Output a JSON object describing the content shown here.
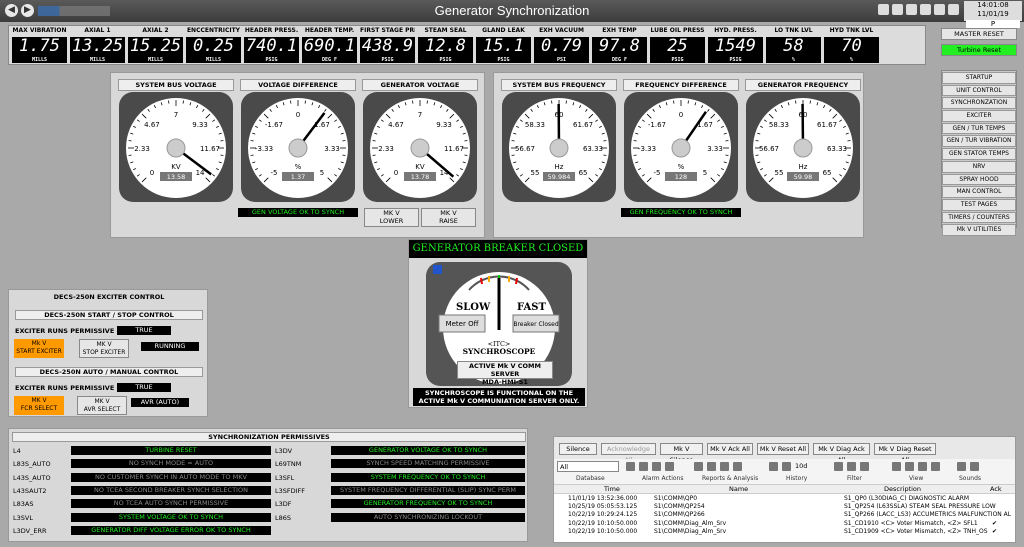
{
  "window": {
    "title": "Generator Synchronization",
    "clock_time": "14:01:08 11/01/19",
    "clock_user": "P",
    "nav_back": "◀",
    "nav_forward": "▶"
  },
  "readings": [
    {
      "label": "MAX VIBRATION",
      "value": "1.75",
      "unit": "MILLS"
    },
    {
      "label": "AXIAL 1",
      "value": "13.25",
      "unit": "MILLS"
    },
    {
      "label": "AXIAL 2",
      "value": "15.25",
      "unit": "MILLS"
    },
    {
      "label": "ENCCENTRICITY",
      "value": "0.25",
      "unit": "MILLS"
    },
    {
      "label": "HEADER PRESS.",
      "value": "740.1",
      "unit": "PSIG"
    },
    {
      "label": "HEADER TEMP.",
      "value": "690.1",
      "unit": "DEG F"
    },
    {
      "label": "FIRST STAGE PRESS",
      "value": "438.9",
      "unit": "PSIG"
    },
    {
      "label": "STEAM SEAL",
      "value": "12.8",
      "unit": "PSIG"
    },
    {
      "label": "GLAND LEAK",
      "value": "15.1",
      "unit": "PSIG"
    },
    {
      "label": "EXH VACUUM",
      "value": "0.79",
      "unit": "PSI"
    },
    {
      "label": "EXH TEMP",
      "value": "97.8",
      "unit": "DEG F"
    },
    {
      "label": "LUBE OIL PRESS",
      "value": "25",
      "unit": "PSIG"
    },
    {
      "label": "HYD. PRESS.",
      "value": "1549",
      "unit": "PSIG"
    },
    {
      "label": "LO TNK LVL",
      "value": "58",
      "unit": "%"
    },
    {
      "label": "HYD TNK LVL",
      "value": "70",
      "unit": "%"
    }
  ],
  "buttons": {
    "master_reset": "MASTER RESET",
    "turbine_reset": "Turbine Reset"
  },
  "nav_menu": [
    "STARTUP",
    "UNIT CONTROL",
    "SYNCHRONZATION",
    "EXCITER",
    "GEN / TUR TEMPS",
    "GEN / TUR VIBRATION",
    "GEN STATOR TEMPS",
    "NRV",
    "SPRAY HOOD",
    "MAN CONTROL",
    "TEST PAGES",
    "TIMERS / COUNTERS",
    "Mk V UTILITIES"
  ],
  "gauges": [
    {
      "title": "SYSTEM BUS VOLTAGE",
      "unit": "KV",
      "readout": "13.58",
      "ticks": [
        "0",
        "2.33",
        "4.67",
        "7",
        "9.33",
        "11.67",
        "14"
      ]
    },
    {
      "title": "VOLTAGE DIFFERENCE",
      "unit": "%",
      "readout": "1.37",
      "ticks": [
        "-5",
        "-3.33",
        "-1.67",
        "0",
        "1.67",
        "3.33",
        "5"
      ]
    },
    {
      "title": "GENERATOR VOLTAGE",
      "unit": "KV",
      "readout": "13.78",
      "ticks": [
        "0",
        "2.33",
        "4.67",
        "7",
        "9.33",
        "11.67",
        "14"
      ]
    },
    {
      "title": "SYSTEM BUS FREQUENCY",
      "unit": "Hz",
      "readout": "59.984",
      "ticks": [
        "55",
        "56.67",
        "58.33",
        "60",
        "61.67",
        "63.33",
        "65"
      ]
    },
    {
      "title": "FREQUENCY DIFFERENCE",
      "unit": "%",
      "readout": "128",
      "ticks": [
        "-5",
        "-3.33",
        "-1.67",
        "0",
        "1.67",
        "3.33",
        "5"
      ]
    },
    {
      "title": "GENERATOR FREQUENCY",
      "unit": "Hz",
      "readout": "59.98",
      "ticks": [
        "55",
        "56.67",
        "58.33",
        "60",
        "61.67",
        "63.33",
        "65"
      ]
    }
  ],
  "gauge_values": [
    13.58,
    1.37,
    13.78,
    59.984,
    1.28,
    59.98
  ],
  "gauge_ranges": [
    [
      0,
      14
    ],
    [
      -5,
      5
    ],
    [
      0,
      14
    ],
    [
      55,
      65
    ],
    [
      -5,
      5
    ],
    [
      55,
      65
    ]
  ],
  "status": {
    "gen_voltage_ok": "GEN VOLTAGE OK TO SYNCH",
    "gen_freq_ok": "GEN FREQUENCY OK TO SYNCH",
    "mkv_lower": "MK V\nLOWER",
    "mkv_raise": "MK V\nRAISE"
  },
  "synchroscope": {
    "header": "GENERATOR BREAKER CLOSED",
    "slow": "SLOW",
    "fast": "FAST",
    "meter_off": "Meter Off",
    "breaker": "Breaker Closed",
    "itc": "<ITC>",
    "name": "SYNCHROSCOPE",
    "server_line1": "ACTIVE Mk V COMM SERVER",
    "server_line2": "MDA-HMI-S1",
    "note1": "SYNCHROSCOPE IS FUNCTIONAL ON THE",
    "note2": "ACTIVE Mk V COMMUNIATION SERVER ONLY."
  },
  "decs": {
    "title": "DECS-250N EXCITER CONTROL",
    "start_stop": "DECS-250N START / STOP CONTROL",
    "exciter_runs_permissive": "EXCITER RUNS PERMISSIVE",
    "true1": "TRUE",
    "start_exciter": "Mk V\nSTART EXCITER",
    "stop_exciter": "MK V\nSTOP EXCITER",
    "running": "RUNNING",
    "auto_manual": "DECS-250N AUTO / MANUAL CONTROL",
    "exciter_runs_permissive2": "EXCITER RUNS PERMISSIVE",
    "true2": "TRUE",
    "fcr_select": "MK V\nFCR SELECT",
    "avr_select": "MK V\nAVR SELECT",
    "avr_auto": "AVR (AUTO)"
  },
  "permissives": {
    "title": "SYNCHRONIZATION PERMISSIVES",
    "left": [
      {
        "tag": "L4",
        "text": "TURBINE RESET",
        "state": "green"
      },
      {
        "tag": "L83S_AUTO",
        "text": "NO SYNCH MODE = AUTO",
        "state": "gray"
      },
      {
        "tag": "L43S_AUTO",
        "text": "NO CUSTOMER SYNCH  IN AUTO MODE TO MKV",
        "state": "gray"
      },
      {
        "tag": "L43SAUT2",
        "text": "NO TCEA SECOND BREAKER SYNCH SELECTION",
        "state": "gray"
      },
      {
        "tag": "L83AS",
        "text": "NO TCEA AUTO SYNCH PERMISSIVE",
        "state": "gray"
      },
      {
        "tag": "L3SVL",
        "text": "SYSTEM VOLTAGE OK TO SYNCH",
        "state": "green"
      },
      {
        "tag": "L3DV_ERR",
        "text": "GENERATOR DIFF VOLTAGE ERROR OK TO SYNCH",
        "state": "green"
      }
    ],
    "right": [
      {
        "tag": "L3DV",
        "text": "GENERATOR VOLTAGE OK TO SYNCH",
        "state": "green"
      },
      {
        "tag": "L69TNM",
        "text": "SYNCH SPEED MATCHING PERMISSIVE",
        "state": "gray"
      },
      {
        "tag": "L3SFL",
        "text": "SYSTEM FREQUENCY OK TO SYNCH",
        "state": "green"
      },
      {
        "tag": "L3SFDIFF",
        "text": "SYSTEM FREQUENCY DIFFERENTIAL (SLIP) SYNC PERM",
        "state": "gray"
      },
      {
        "tag": "L3DF",
        "text": "GENERATOR FREQUENCY OK TO SYNCH",
        "state": "green"
      },
      {
        "tag": "L86S",
        "text": "AUTO SYNCHRONIZING LOCKOUT",
        "state": "gray"
      }
    ]
  },
  "alarms": {
    "buttons": [
      "Silence",
      "Acknowledge All",
      "Mk V Silence",
      "Mk V Ack All",
      "Mk V Reset All",
      "Mk V Diag Ack All",
      "Mk V Diag Reset All"
    ],
    "filter_value": "All",
    "toolbar_labels": [
      "Database",
      "Alarm Actions",
      "Reports & Analysis",
      "History",
      "Filter",
      "View",
      "Sounds"
    ],
    "history_value": "10d",
    "columns": [
      "Time",
      "Name",
      "Description",
      "Ack"
    ],
    "rows": [
      {
        "time": "11/01/19  13:52:36.000",
        "name": "S1\\COMM\\QP0",
        "desc": "S1_QP0 (L30DIAG_C) DIAGNOSTIC ALARM",
        "ack": ""
      },
      {
        "time": "10/25/19  05:05:53.125",
        "name": "S1\\COMM\\QP254",
        "desc": "S1_QP254 (L63SSLA) STEAM SEAL PRESSURE LOW",
        "ack": ""
      },
      {
        "time": "10/22/19  10:29:24.125",
        "name": "S1\\COMM\\QP266",
        "desc": "S1_QP266 (LACC_LS3) ACCUMETRICS MALFUNCTION AL",
        "ack": ""
      },
      {
        "time": "10/22/19  10:10:50.000",
        "name": "S1\\COMM\\Diag_Alm_Srv",
        "desc": "S1_CD1910 <C> Voter Mismatch, <Z> SFL1",
        "ack": "✔"
      },
      {
        "time": "10/22/19  10:10:50.000",
        "name": "S1\\COMM\\Diag_Alm_Srv",
        "desc": "S1_CD1909 <C> Voter Mismatch, <Z> TNH_OS",
        "ack": "✔"
      }
    ]
  }
}
